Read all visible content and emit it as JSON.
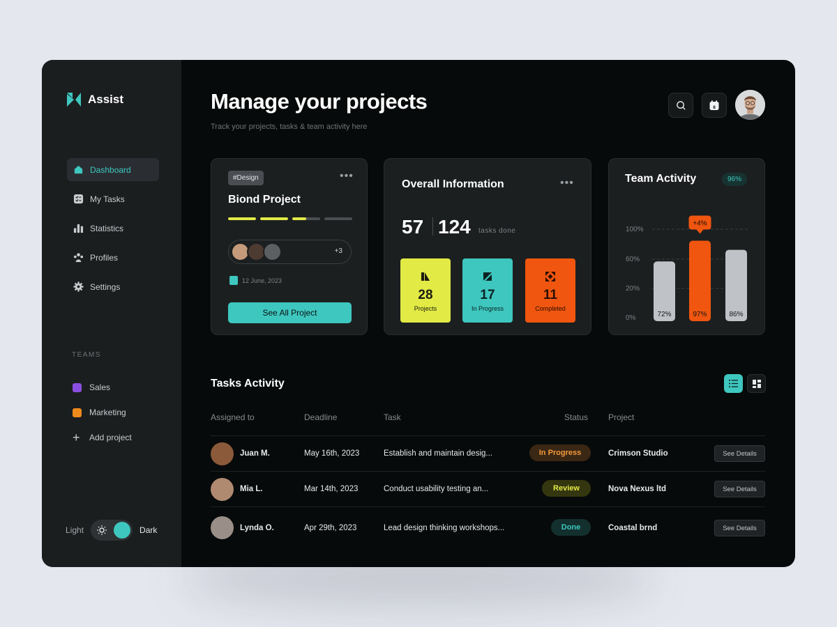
{
  "app": {
    "name": "Assist",
    "brand_color": "#3ec7bf"
  },
  "sidebar": {
    "items": [
      {
        "label": "Dashboard",
        "icon": "home-icon",
        "active": true
      },
      {
        "label": "My Tasks",
        "icon": "checklist-icon",
        "active": false
      },
      {
        "label": "Statistics",
        "icon": "bar-chart-icon",
        "active": false
      },
      {
        "label": "Profiles",
        "icon": "users-icon",
        "active": false
      },
      {
        "label": "Settings",
        "icon": "gear-icon",
        "active": false
      }
    ],
    "teams_label": "TEAMS",
    "teams": [
      {
        "label": "Sales",
        "color": "#8a4fe0"
      },
      {
        "label": "Marketing",
        "color": "#f08a1c"
      }
    ],
    "add_project_label": "Add project",
    "theme": {
      "light_label": "Light",
      "dark_label": "Dark",
      "mode": "dark"
    }
  },
  "header": {
    "title": "Manage your projects",
    "subtitle": "Track your  projects, tasks & team activity here",
    "calendar_badge": "8"
  },
  "project_card": {
    "tag": "#Design",
    "title": "Biond Project",
    "progress_segments": [
      1,
      1,
      0.5,
      0
    ],
    "extra_members": "+3",
    "date": "12 June, 2023",
    "button_label": "See All Project"
  },
  "overall_info": {
    "title": "Overall Information",
    "primary_count": "57",
    "total_count": "124",
    "tasks_done_label": "tasks done",
    "tiles": [
      {
        "value": "28",
        "label": "Projects",
        "color": "#e2ea45",
        "text_color": "#1a1c10"
      },
      {
        "value": "17",
        "label": "In Progress",
        "color": "#3ec7bf",
        "text_color": "#0b2221"
      },
      {
        "value": "11",
        "label": "Completed",
        "color": "#f0560f",
        "text_color": "#2a0e02"
      }
    ]
  },
  "team_activity": {
    "title": "Team Activity",
    "badge": "96%",
    "callout": "+4%"
  },
  "chart_data": {
    "type": "bar",
    "categories": [
      "",
      "",
      ""
    ],
    "values": [
      72,
      97,
      86
    ],
    "value_labels": [
      "72%",
      "97%",
      "86%"
    ],
    "y_ticks": [
      "100%",
      "60%",
      "20%",
      "0%"
    ],
    "ylim": [
      0,
      100
    ],
    "highlight_index": 1,
    "bar_colors": [
      "#bfc2c7",
      "#f0560f",
      "#bfc2c7"
    ],
    "grid": true
  },
  "tasks": {
    "title": "Tasks Activity",
    "columns": [
      "Assigned to",
      "Deadline",
      "Task",
      "Status",
      "Project"
    ],
    "details_label": "See Details",
    "rows": [
      {
        "name": "Juan M.",
        "deadline": "May 16th, 2023",
        "task": "Establish and maintain desig...",
        "status": "In Progress",
        "status_bg": "#3a2714",
        "status_fg": "#f59a3b",
        "project": "Crimson Studio",
        "avatar_color": "#8a5a3a"
      },
      {
        "name": "Mia L.",
        "deadline": "Mar 14th, 2023",
        "task": "Conduct usability testing an...",
        "status": "Review",
        "status_bg": "#34360f",
        "status_fg": "#e2ea45",
        "project": "Nova Nexus ltd",
        "avatar_color": "#b08a70"
      },
      {
        "name": "Lynda O.",
        "deadline": "Apr 29th, 2023",
        "task": "Lead design thinking workshops...",
        "status": "Done",
        "status_bg": "#13302e",
        "status_fg": "#3ec7bf",
        "project": "Coastal brnd",
        "avatar_color": "#9a8f88"
      }
    ]
  }
}
